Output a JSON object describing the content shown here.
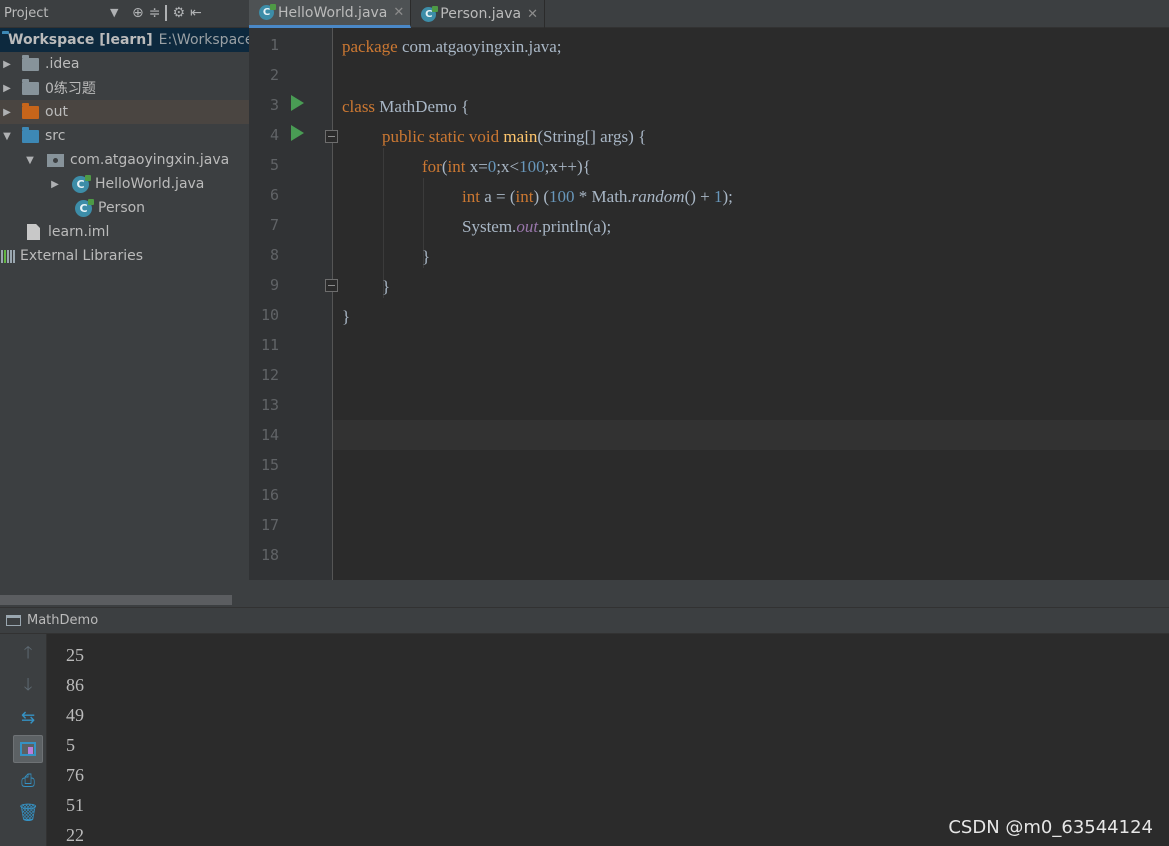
{
  "project_panel": {
    "title": "Project",
    "tree": [
      {
        "label": "Workspace [learn]",
        "path": "E:\\Workspace",
        "icon": "module-folder-icon"
      },
      {
        "label": ".idea",
        "icon": "folder-icon"
      },
      {
        "label": "0练习题",
        "icon": "folder-icon"
      },
      {
        "label": "out",
        "icon": "excluded-folder-icon"
      },
      {
        "label": "src",
        "icon": "source-folder-icon"
      },
      {
        "label": "com.atgaoyingxin.java",
        "icon": "package-icon"
      },
      {
        "label": "HelloWorld.java",
        "icon": "java-class-icon"
      },
      {
        "label": "Person",
        "icon": "java-class-icon"
      },
      {
        "label": "learn.iml",
        "icon": "iml-file-icon"
      },
      {
        "label": "External Libraries",
        "icon": "library-icon"
      }
    ]
  },
  "editor": {
    "tabs": [
      {
        "label": "HelloWorld.java",
        "active": true
      },
      {
        "label": "Person.java",
        "active": false
      }
    ],
    "line_numbers": [
      "1",
      "2",
      "3",
      "4",
      "5",
      "6",
      "7",
      "8",
      "9",
      "10",
      "11",
      "12",
      "13",
      "14",
      "15",
      "16",
      "17",
      "18"
    ],
    "current_line": "14",
    "code": {
      "l1_kw": "package",
      "l1_rest": " com.atgaoyingxin.java;",
      "l3_kw": "class",
      "l3_rest": " MathDemo {",
      "l4_kw": "public static void ",
      "l4_fn": "main",
      "l4_rest": "(String[] args) {",
      "l5_kw": "for",
      "l5_a": "(",
      "l5_kw2": "int",
      "l5_b": " x=",
      "l5_n1": "0",
      "l5_c": ";x<",
      "l5_n2": "100",
      "l5_d": ";x++){",
      "l6_kw": "int",
      "l6_a": " a = (",
      "l6_kw2": "int",
      "l6_b": ") (",
      "l6_n1": "100",
      "l6_c": " * Math.",
      "l6_fn": "random",
      "l6_d": "() + ",
      "l6_n2": "1",
      "l6_e": ");",
      "l7_a": "System.",
      "l7_field": "out",
      "l7_b": ".println(a);",
      "l8": "}",
      "l9": "}",
      "l10": "}"
    }
  },
  "run_panel": {
    "tab_label": "MathDemo",
    "output": [
      "25",
      "86",
      "49",
      "5",
      "76",
      "51",
      "22"
    ]
  },
  "watermark": "CSDN @m0_63544124",
  "colors": {
    "keyword": "#cc7832",
    "number": "#6897bb",
    "method": "#ffc66d",
    "field": "#9876aa",
    "run_icon": "#499c54",
    "accent": "#4a88c7"
  }
}
